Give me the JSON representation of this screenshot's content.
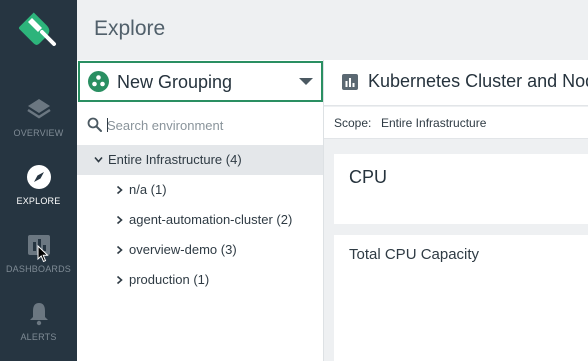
{
  "nav": {
    "items": [
      {
        "label": "OVERVIEW",
        "icon": "layers-icon"
      },
      {
        "label": "EXPLORE",
        "icon": "compass-icon"
      },
      {
        "label": "DASHBOARDS",
        "icon": "dashboard-icon"
      },
      {
        "label": "ALERTS",
        "icon": "bell-icon"
      }
    ],
    "active": "EXPLORE"
  },
  "header": {
    "title": "Explore"
  },
  "grouping": {
    "label": "New Grouping"
  },
  "search": {
    "placeholder": "Search environment"
  },
  "tree": {
    "root": {
      "label": "Entire Infrastructure (4)"
    },
    "children": [
      {
        "label": "n/a (1)"
      },
      {
        "label": "agent-automation-cluster (2)"
      },
      {
        "label": "overview-demo (3)"
      },
      {
        "label": "production (1)"
      }
    ]
  },
  "chart": {
    "title": "Kubernetes Cluster and Node",
    "scope_label": "Scope:",
    "scope_value": "Entire Infrastructure"
  },
  "cards": {
    "cpu_title": "CPU",
    "capacity_title": "Total CPU Capacity"
  },
  "colors": {
    "nav_bg": "#263541",
    "accent_green": "#2a8f62",
    "selected_row": "#e4e7ea"
  }
}
